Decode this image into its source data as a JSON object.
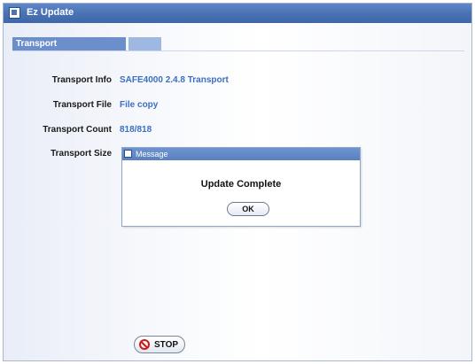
{
  "window": {
    "title": "Ez Update"
  },
  "tabs": [
    {
      "label": "Transport"
    }
  ],
  "fields": {
    "info": {
      "label": "Transport Info",
      "value": "SAFE4000 2.4.8 Transport"
    },
    "file": {
      "label": "Transport File",
      "value": "File copy"
    },
    "count": {
      "label": "Transport Count",
      "value": "818/818"
    },
    "size": {
      "label": "Transport Size",
      "value": ""
    }
  },
  "dialog": {
    "title": "Message",
    "message": "Update Complete",
    "ok_label": "OK"
  },
  "stop_button": {
    "label": "STOP"
  },
  "colors": {
    "title_bar": "#4a73b6",
    "value_text": "#3b6fc2",
    "stop_icon": "#cc1a1a"
  }
}
